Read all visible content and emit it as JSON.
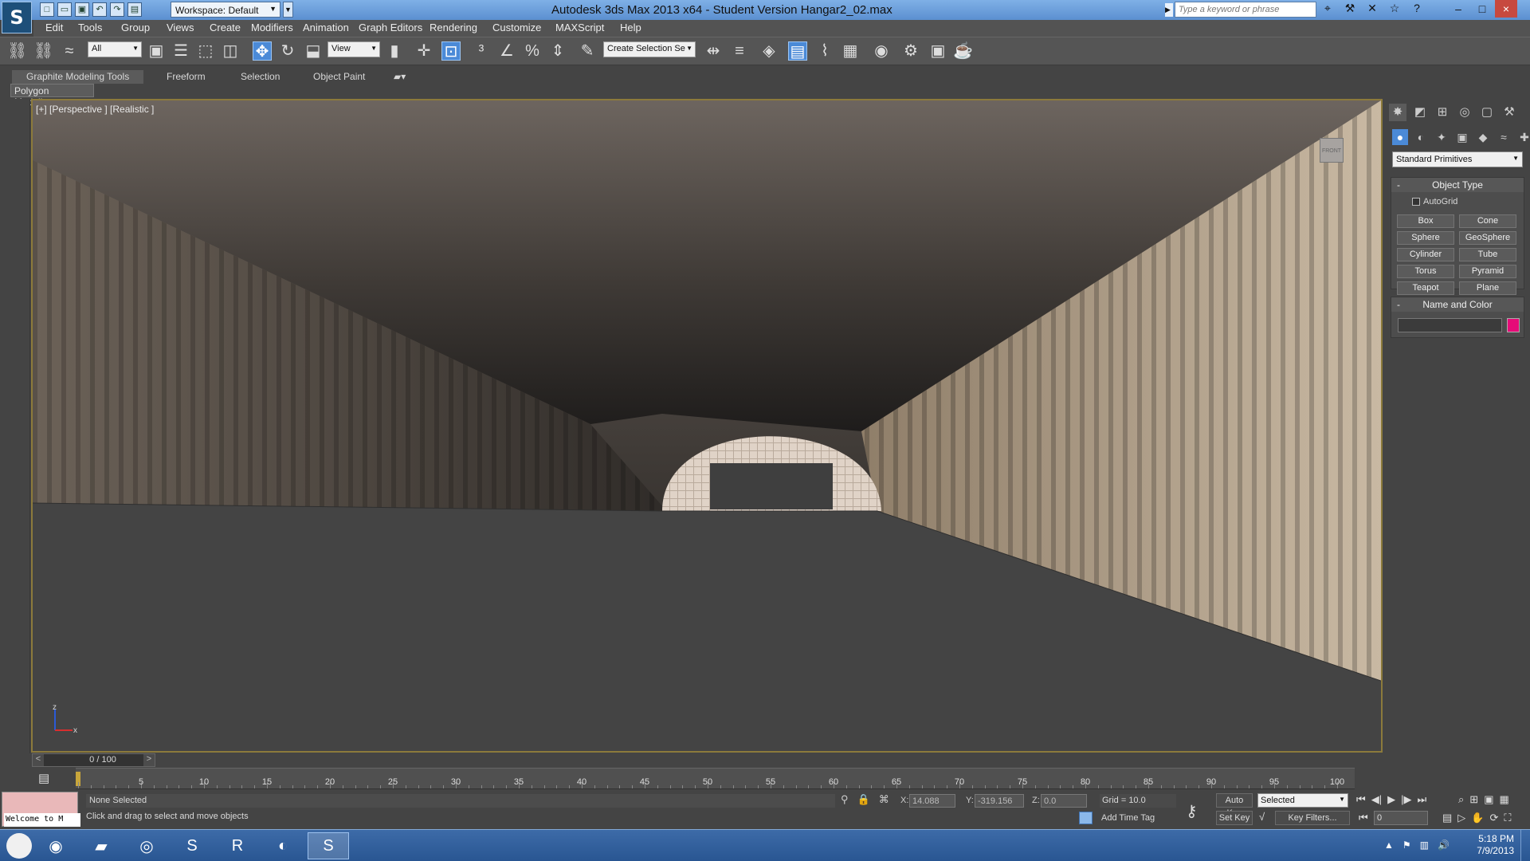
{
  "app": {
    "title": "Autodesk 3ds Max  2013 x64  - Student Version   Hangar2_02.max",
    "workspace": "Workspace: Default",
    "search_placeholder": "Type a keyword or phrase"
  },
  "menus": [
    "Edit",
    "Tools",
    "Group",
    "Views",
    "Create",
    "Modifiers",
    "Animation",
    "Graph Editors",
    "Rendering",
    "Customize",
    "MAXScript",
    "Help"
  ],
  "toolbar": {
    "filter": "All",
    "ref_coord": "View",
    "named_selection": "Create Selection Se"
  },
  "ribbon": {
    "tabs": [
      "Graphite Modeling Tools",
      "Freeform",
      "Selection",
      "Object Paint"
    ],
    "active_tab": "Graphite Modeling Tools",
    "panel": "Polygon Modeling"
  },
  "viewport": {
    "label": "[+] [Perspective ] [Realistic ]",
    "viewcube": "FRONT",
    "axis": {
      "z": "z",
      "x": "x"
    }
  },
  "command_panel": {
    "category": "Standard Primitives",
    "object_type_title": "Object Type",
    "autogrid": "AutoGrid",
    "buttons": [
      "Box",
      "Cone",
      "Sphere",
      "GeoSphere",
      "Cylinder",
      "Tube",
      "Torus",
      "Pyramid",
      "Teapot",
      "Plane"
    ],
    "name_color_title": "Name and Color",
    "object_color": "#e60b78"
  },
  "timeline": {
    "current": "0 / 100",
    "ticks": [
      "5",
      "10",
      "15",
      "20",
      "25",
      "30",
      "35",
      "40",
      "45",
      "50",
      "55",
      "60",
      "65",
      "70",
      "75",
      "80",
      "85",
      "90",
      "95",
      "100"
    ]
  },
  "status": {
    "selection": "None Selected",
    "prompt": "Click and drag to select and move objects",
    "listener": "Welcome to M",
    "x_label": "X:",
    "x": "14.088",
    "y_label": "Y:",
    "y": "-319.156",
    "z_label": "Z:",
    "z": "0.0",
    "grid": "Grid = 10.0",
    "add_time_tag": "Add Time Tag",
    "auto_key": "Auto Key",
    "set_key": "Set Key",
    "selected": "Selected",
    "key_filters": "Key Filters...",
    "frame": "0"
  },
  "taskbar": {
    "time": "5:18 PM",
    "date": "7/9/2013"
  }
}
